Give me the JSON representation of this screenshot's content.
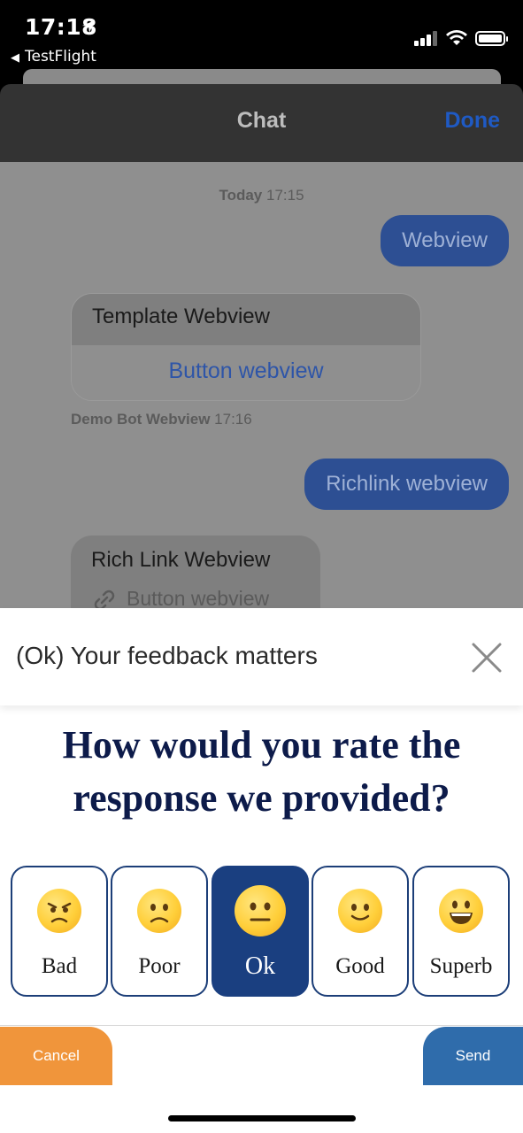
{
  "status_bar": {
    "time": "17:18",
    "back_app": "TestFlight"
  },
  "chat": {
    "title": "Chat",
    "done_label": "Done",
    "timestamp_day": "Today",
    "timestamp_time": "17:15",
    "messages": {
      "out1": "Webview",
      "card_title": "Template Webview",
      "card_button": "Button webview",
      "sender_name": "Demo Bot Webview",
      "sender_time": "17:16",
      "out2": "Richlink webview",
      "rich_title": "Rich Link Webview",
      "rich_link": "Button webview"
    }
  },
  "feedback": {
    "title": "(Ok) Your feedback matters",
    "question_line1": "How would you rate the",
    "question_line2": "response we provided?",
    "options": [
      {
        "label": "Bad",
        "icon": "angry-face-icon"
      },
      {
        "label": "Poor",
        "icon": "slightly-frowning-face-icon"
      },
      {
        "label": "Ok",
        "icon": "neutral-face-icon",
        "selected": true
      },
      {
        "label": "Good",
        "icon": "slightly-smiling-face-icon"
      },
      {
        "label": "Superb",
        "icon": "grinning-face-icon"
      }
    ],
    "cancel_label": "Cancel",
    "send_label": "Send",
    "colors": {
      "selected": "#1a3f80",
      "cancel": "#f0953b",
      "send": "#2f6cab",
      "question": "#0d1b4a"
    }
  }
}
